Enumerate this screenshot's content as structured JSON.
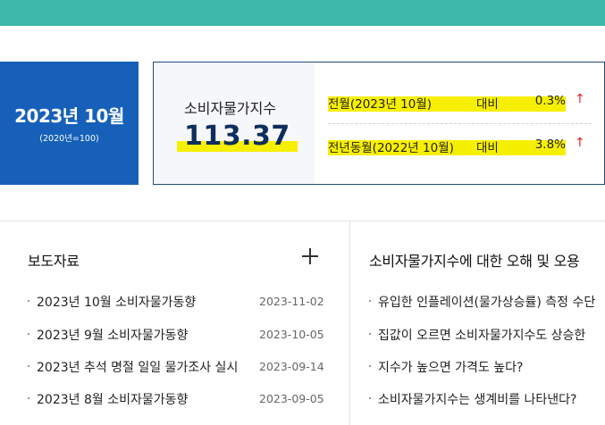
{
  "colors": {
    "topbar": "#3db8aa",
    "period_bg": "#1660b9",
    "value": "#0e2e5c",
    "highlight": "#f7ef00",
    "arrow_up": "#e02020"
  },
  "summary": {
    "period": "2023년 10월",
    "base": "(2020년=100)",
    "index_label": "소비자물가지수",
    "index_value": "113.37",
    "rows": [
      {
        "label": "전월(2023년 10월)",
        "compare": "대비",
        "pct": "0.3%",
        "arrow": "↑"
      },
      {
        "label": "전년동월(2022년 10월)",
        "compare": "대비",
        "pct": "3.8%",
        "arrow": "↑"
      }
    ]
  },
  "press": {
    "title": "보도자료",
    "more_icon": "plus-icon",
    "items": [
      {
        "title": "2023년 10월 소비자물가동향",
        "date": "2023-11-02"
      },
      {
        "title": "2023년 9월 소비자물가동향",
        "date": "2023-10-05"
      },
      {
        "title": "2023년 추석 명절 일일 물가조사 실시",
        "date": "2023-09-14"
      },
      {
        "title": "2023년 8월 소비자물가동향",
        "date": "2023-09-05"
      }
    ]
  },
  "faq": {
    "title": "소비자물가지수에 대한 오해 및 오용",
    "items": [
      {
        "title": "유입한 인플레이션(물가상승률) 측정 수단"
      },
      {
        "title": "집값이 오르면 소비자물가지수도 상승한"
      },
      {
        "title": "지수가 높으면 가격도 높다?"
      },
      {
        "title": "소비자물가지수는 생계비를 나타낸다?"
      }
    ]
  }
}
